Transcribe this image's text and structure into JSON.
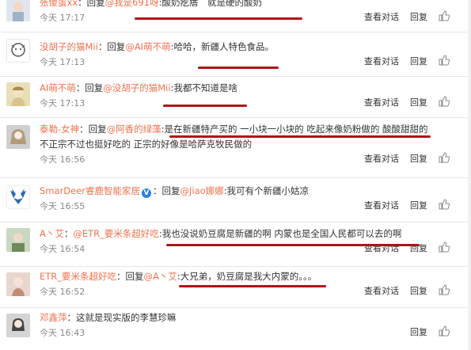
{
  "reply_label": "：回复",
  "actions": {
    "view": "查看对话",
    "reply": "回复"
  },
  "comments": [
    {
      "user": "张傻蛋xx",
      "mention": "@我是691呀",
      "body": ":酸奶疙瘩　就是硬的酸奶",
      "body2": "",
      "time": "今天 17:17"
    },
    {
      "user": "没胡子的猫Mii",
      "mention": "@AI萌不萌",
      "body": ":哈哈，新疆人特色食品。",
      "body2": "",
      "time": "今天 17:13"
    },
    {
      "user": "AI萌不萌",
      "mention": "@没胡子的猫Mii",
      "body": ":我都不知道是啥",
      "body2": "",
      "time": "今天 17:13"
    },
    {
      "user": "泰勒-女神",
      "mention": "@阿香的绿藻",
      "body": ":是在新疆特产买的 一小块一小块的 吃起来像奶粉做的 酸酸甜甜的",
      "body2": "不正宗不过也挺好吃的 正宗的好像是哈萨克牧民做的",
      "time": "今天 16:56"
    },
    {
      "user": "SmarDeer睿鹿智能家居",
      "mention": "@Jiao娜娜",
      "body": ":我可有个新疆小姑凉",
      "body2": "",
      "time": "今天 16:55"
    },
    {
      "user": "A丶艾",
      "mention": "@ETR_要米条超好吃",
      "body": ":我也没说奶豆腐是新疆的啊 内蒙也是全国人民都可以去的啊",
      "body2": "",
      "time": "今天 16:54"
    },
    {
      "user": "ETR_要米条超好吃",
      "mention": "@A丶艾",
      "body": ":大兄弟，奶豆腐是我大内蒙的。。。",
      "body2": "",
      "time": "今天 16:52"
    },
    {
      "user": "邓鑫萍",
      "mention": "",
      "body": "：这就是现实版的李慧珍嘛",
      "body2": "",
      "time": "今天 16:43"
    }
  ]
}
